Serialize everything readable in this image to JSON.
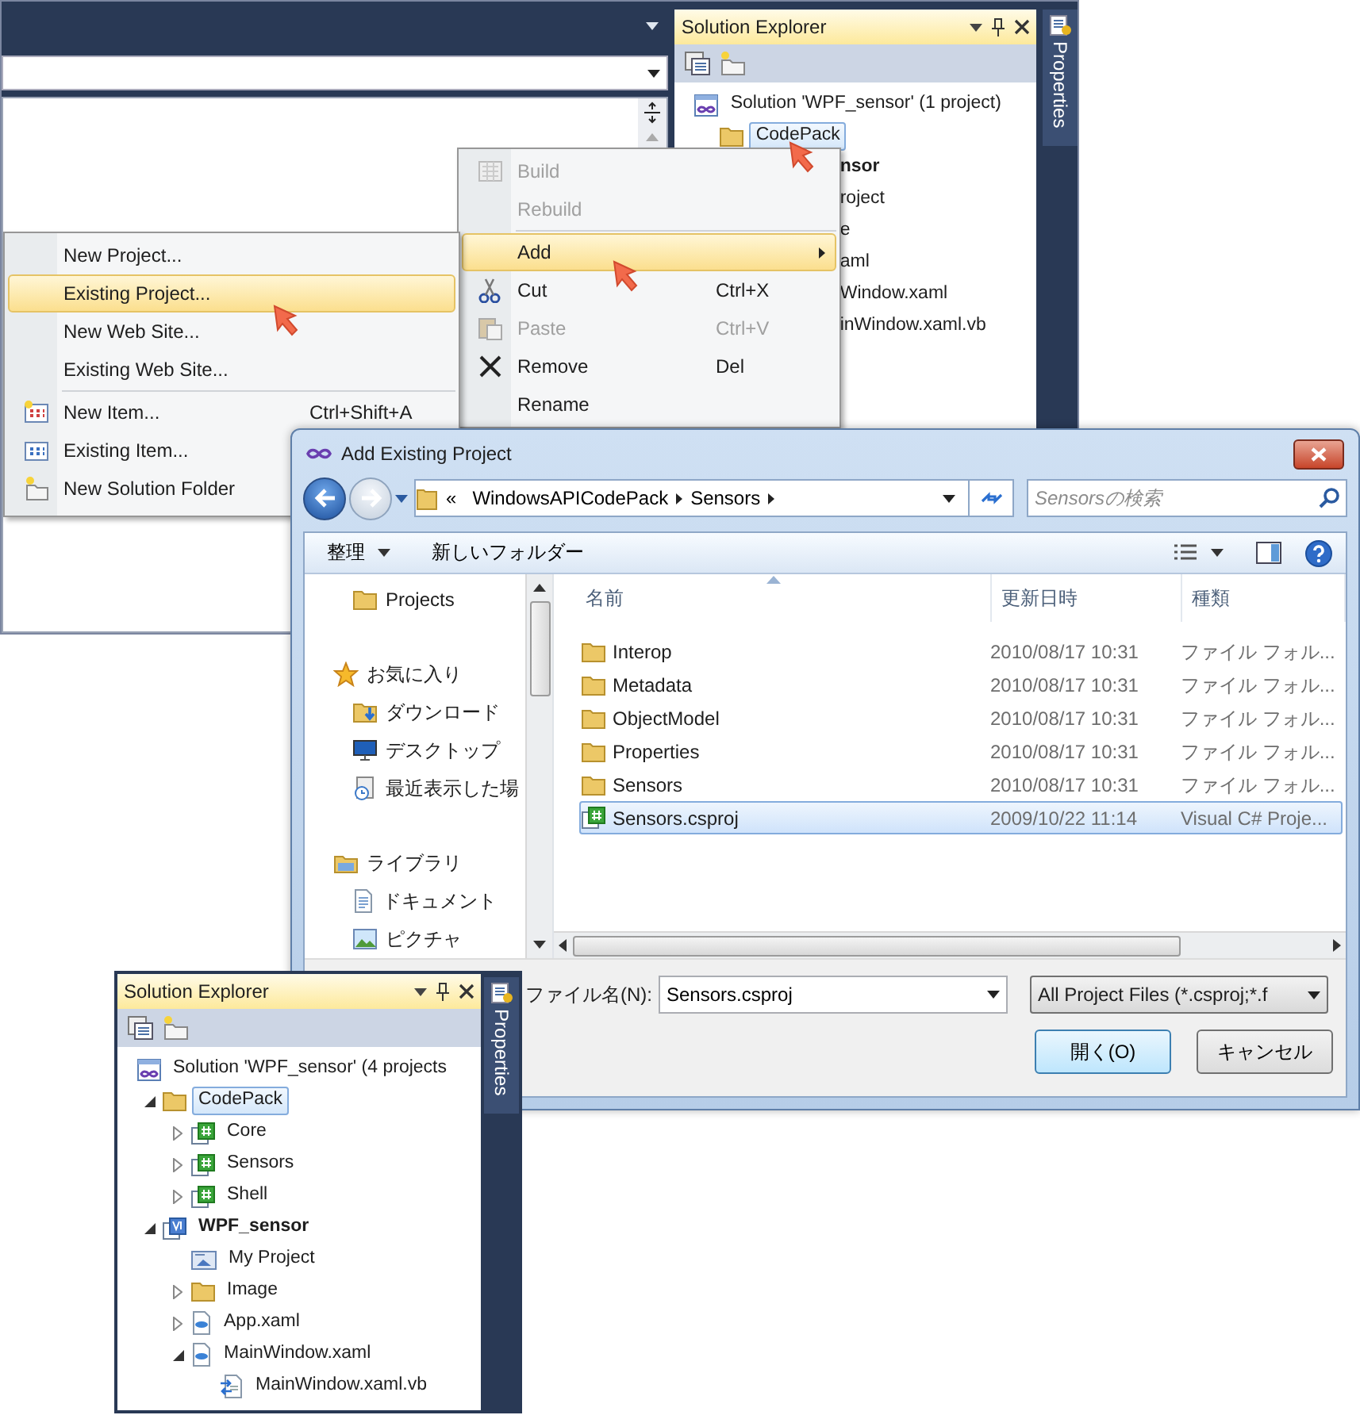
{
  "ide": {
    "explorer": {
      "title": "Solution Explorer",
      "tree": [
        {
          "label": "Solution 'WPF_sensor' (1 project)",
          "kind": "solution",
          "children": [
            {
              "label": "CodePack",
              "kind": "folder",
              "selected": true
            }
          ]
        }
      ],
      "covered_rows": [
        {
          "text": "nsor",
          "bold": true
        },
        {
          "text": "roject",
          "bold": false
        },
        {
          "text": "e",
          "bold": false
        },
        {
          "text": "aml",
          "bold": false
        },
        {
          "text": "Window.xaml",
          "bold": false
        },
        {
          "text": "inWindow.xaml.vb",
          "bold": false
        }
      ]
    },
    "side_tab": "Properties"
  },
  "context_menu": {
    "items": [
      {
        "kind": "command",
        "label": "Build",
        "disabled": true,
        "selected": false
      },
      {
        "kind": "command",
        "label": "Rebuild",
        "disabled": true,
        "selected": false
      },
      {
        "kind": "separator"
      },
      {
        "kind": "submenu",
        "label": "Add",
        "disabled": false,
        "selected": true
      },
      {
        "kind": "command",
        "label": "Cut",
        "shortcut": "Ctrl+X",
        "disabled": false,
        "selected": false
      },
      {
        "kind": "command",
        "label": "Paste",
        "shortcut": "Ctrl+V",
        "disabled": true,
        "selected": false
      },
      {
        "kind": "command",
        "label": "Remove",
        "shortcut": "Del",
        "disabled": false,
        "selected": false
      },
      {
        "kind": "command",
        "label": "Rename",
        "disabled": false,
        "selected": false
      }
    ]
  },
  "add_submenu": {
    "items": [
      {
        "kind": "command",
        "label": "New Project...",
        "disabled": false,
        "selected": false
      },
      {
        "kind": "command",
        "label": "Existing Project...",
        "disabled": false,
        "selected": true
      },
      {
        "kind": "command",
        "label": "New Web Site...",
        "disabled": false,
        "selected": false
      },
      {
        "kind": "command",
        "label": "Existing Web Site...",
        "disabled": false,
        "selected": false
      },
      {
        "kind": "separator"
      },
      {
        "kind": "command",
        "label": "New Item...",
        "shortcut": "Ctrl+Shift+A",
        "disabled": false,
        "selected": false
      },
      {
        "kind": "command",
        "label": "Existing Item...",
        "disabled": false,
        "selected": false
      },
      {
        "kind": "command",
        "label": "New Solution Folder",
        "disabled": false,
        "selected": false
      }
    ]
  },
  "dialog": {
    "title": "Add Existing Project",
    "breadcrumb": {
      "overflow": "«",
      "parts": [
        "WindowsAPICodePack",
        "Sensors"
      ]
    },
    "search": {
      "placeholder": "Sensorsの検索"
    },
    "toolbar": {
      "organize": "整理",
      "new_folder": "新しいフォルダー"
    },
    "nav": [
      {
        "children": [
          {
            "label": "Projects",
            "kind": "folder"
          }
        ]
      },
      {
        "label": "お気に入り",
        "kind": "favorites",
        "children": [
          {
            "label": "ダウンロード",
            "kind": "download"
          },
          {
            "label": "デスクトップ",
            "kind": "desktop"
          },
          {
            "label": "最近表示した場",
            "kind": "recent"
          }
        ]
      },
      {
        "label": "ライブラリ",
        "kind": "library",
        "children": [
          {
            "label": "ドキュメント",
            "kind": "document"
          },
          {
            "label": "ピクチャ",
            "kind": "picture"
          }
        ]
      }
    ],
    "columns": [
      "名前",
      "更新日時",
      "種類"
    ],
    "files": [
      {
        "name": "Interop",
        "modified": "2010/08/17 10:31",
        "type": "ファイル フォル...",
        "kind": "folder",
        "selected": false
      },
      {
        "name": "Metadata",
        "modified": "2010/08/17 10:31",
        "type": "ファイル フォル...",
        "kind": "folder",
        "selected": false
      },
      {
        "name": "ObjectModel",
        "modified": "2010/08/17 10:31",
        "type": "ファイル フォル...",
        "kind": "folder",
        "selected": false
      },
      {
        "name": "Properties",
        "modified": "2010/08/17 10:31",
        "type": "ファイル フォル...",
        "kind": "folder",
        "selected": false
      },
      {
        "name": "Sensors",
        "modified": "2010/08/17 10:31",
        "type": "ファイル フォル...",
        "kind": "folder",
        "selected": false
      },
      {
        "name": "Sensors.csproj",
        "modified": "2009/10/22 11:14",
        "type": "Visual C# Proje...",
        "kind": "csproj",
        "selected": true
      }
    ],
    "file_name": {
      "label": "ファイル名(N):",
      "value": "Sensors.csproj"
    },
    "filter": "All Project Files (*.csproj;*.f",
    "buttons": [
      {
        "label": "開く(O)",
        "kind": "default"
      },
      {
        "label": "キャンセル",
        "kind": "normal"
      }
    ]
  },
  "bottom_explorer": {
    "title": "Solution Explorer",
    "side_tab": "Properties",
    "tree": [
      {
        "label": "Solution 'WPF_sensor' (4 projects",
        "kind": "solution",
        "children": [
          {
            "label": "CodePack",
            "kind": "folder",
            "expanded": true,
            "selected": true,
            "children": [
              {
                "label": "Core",
                "kind": "csproj",
                "expanded": false
              },
              {
                "label": "Sensors",
                "kind": "csproj",
                "expanded": false
              },
              {
                "label": "Shell",
                "kind": "csproj",
                "expanded": false
              }
            ]
          },
          {
            "label": "WPF_sensor",
            "kind": "vbproj",
            "bold": true,
            "expanded": true,
            "children": [
              {
                "label": "My Project",
                "kind": "myproject"
              },
              {
                "label": "Image",
                "kind": "folder",
                "expanded": false
              },
              {
                "label": "App.xaml",
                "kind": "xaml",
                "expanded": false
              },
              {
                "label": "MainWindow.xaml",
                "kind": "xaml",
                "expanded": true,
                "children": [
                  {
                    "label": "MainWindow.xaml.vb",
                    "kind": "vbfile"
                  }
                ]
              }
            ]
          }
        ]
      }
    ]
  }
}
